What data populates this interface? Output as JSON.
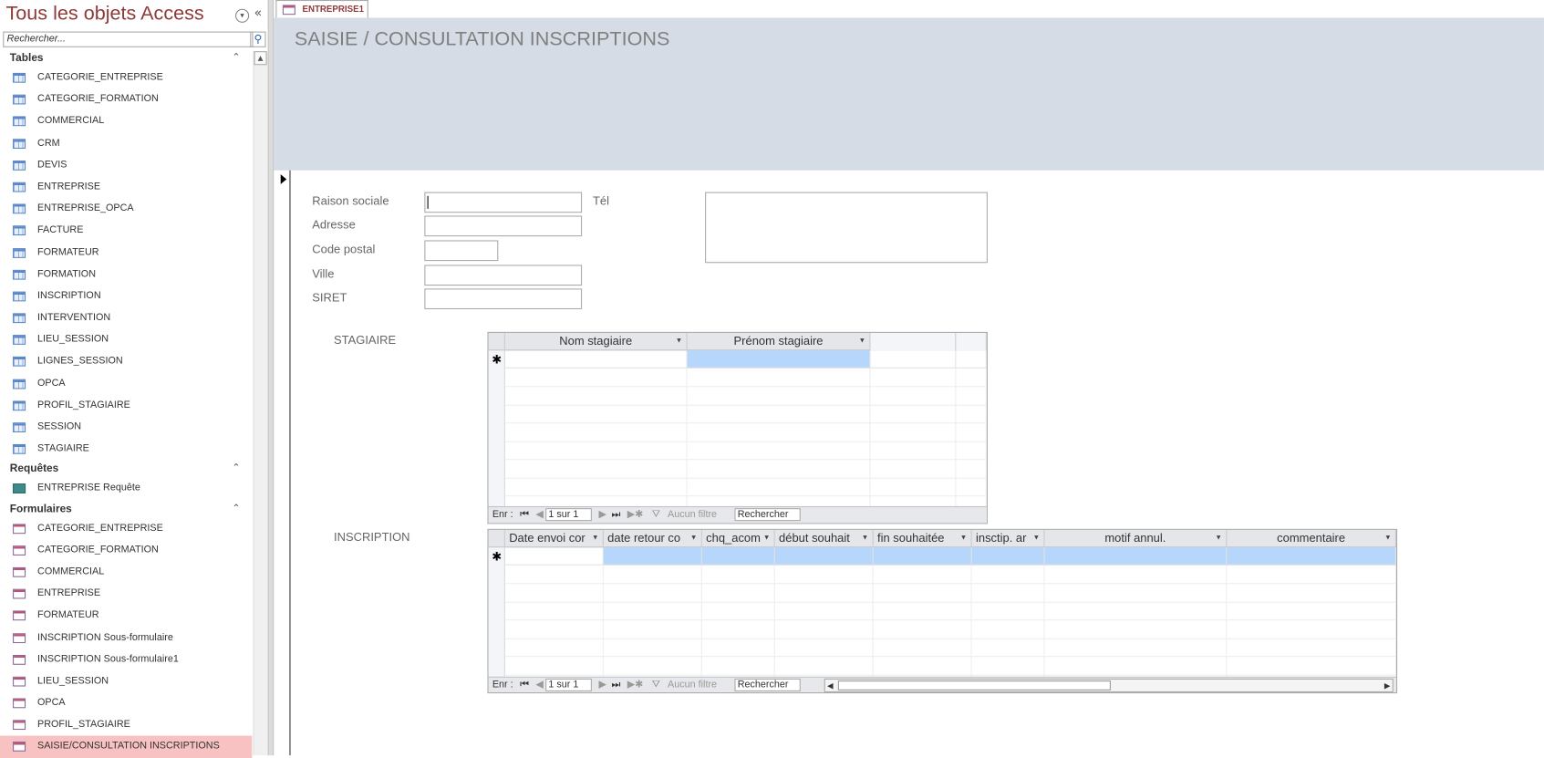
{
  "nav": {
    "title": "Tous les objets Access",
    "search_placeholder": "Rechercher...",
    "groups": [
      {
        "label": "Tables",
        "icon": "table-icon",
        "items": [
          "CATEGORIE_ENTREPRISE",
          "CATEGORIE_FORMATION",
          "COMMERCIAL",
          "CRM",
          "DEVIS",
          "ENTREPRISE",
          "ENTREPRISE_OPCA",
          "FACTURE",
          "FORMATEUR",
          "FORMATION",
          "INSCRIPTION",
          "INTERVENTION",
          "LIEU_SESSION",
          "LIGNES_SESSION",
          "OPCA",
          "PROFIL_STAGIAIRE",
          "SESSION",
          "STAGIAIRE"
        ]
      },
      {
        "label": "Requêtes",
        "icon": "query-icon",
        "items": [
          "ENTREPRISE Requête"
        ]
      },
      {
        "label": "Formulaires",
        "icon": "form-icon",
        "items": [
          "CATEGORIE_ENTREPRISE",
          "CATEGORIE_FORMATION",
          "COMMERCIAL",
          "ENTREPRISE",
          "FORMATEUR",
          "INSCRIPTION Sous-formulaire",
          "INSCRIPTION Sous-formulaire1",
          "LIEU_SESSION",
          "OPCA",
          "PROFIL_STAGIAIRE",
          "SAISIE/CONSULTATION INSCRIPTIONS"
        ]
      }
    ],
    "selected": "SAISIE/CONSULTATION INSCRIPTIONS"
  },
  "tab": {
    "label": "ENTREPRISE1"
  },
  "form": {
    "title": "SAISIE / CONSULTATION INSCRIPTIONS",
    "fields": {
      "raison_sociale": "Raison sociale",
      "adresse": "Adresse",
      "code_postal": "Code postal",
      "ville": "Ville",
      "siret": "SIRET",
      "tel": "Tél"
    },
    "stagiaire": {
      "label": "STAGIAIRE",
      "columns": [
        "Nom stagiaire",
        "Prénom stagiaire"
      ],
      "nav": {
        "prefix": "Enr :",
        "position": "1 sur 1",
        "filter": "Aucun filtre",
        "search": "Rechercher"
      }
    },
    "inscription": {
      "label": "INSCRIPTION",
      "columns": [
        "Date envoi cor",
        "date retour co",
        "chq_acom",
        "début souhait",
        "fin souhaitée",
        "insctip. ar",
        "motif annul.",
        "commentaire"
      ],
      "nav": {
        "prefix": "Enr :",
        "position": "1 sur 1",
        "filter": "Aucun filtre",
        "search": "Rechercher"
      }
    }
  },
  "colors": {
    "accent": "#8e3a3a",
    "header_band": "#d6dce5",
    "selection": "#f9c2c2",
    "new_row": "#b6d7fb"
  }
}
